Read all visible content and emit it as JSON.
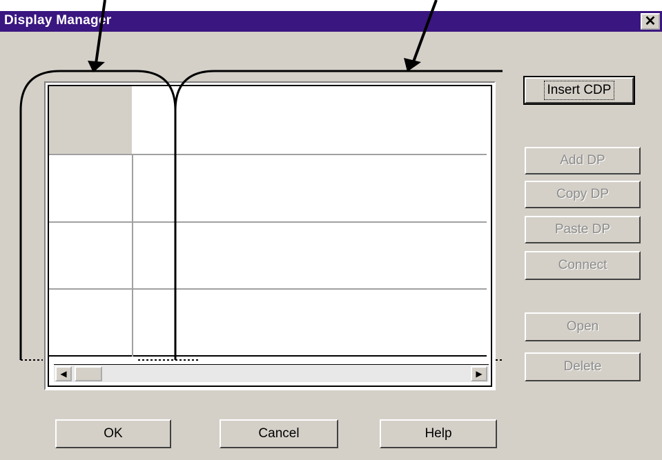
{
  "window": {
    "title": "Display Manager",
    "close_glyph": "✕",
    "colors": {
      "titlebar": "#3a1680",
      "face": "#d4d0c8",
      "disabled_text": "#8c8c8c"
    }
  },
  "grid": {
    "rows": [
      [
        "",
        "",
        ""
      ],
      [
        "",
        "",
        ""
      ],
      [
        "",
        "",
        ""
      ],
      [
        "",
        "",
        ""
      ]
    ],
    "scroll_left_glyph": "◀",
    "scroll_right_glyph": "▶"
  },
  "side_buttons": {
    "insert_cdp": "Insert CDP",
    "add_dp": "Add DP",
    "copy_dp": "Copy DP",
    "paste_dp": "Paste DP",
    "connect": "Connect",
    "open": "Open",
    "delete": "Delete"
  },
  "bottom_buttons": {
    "ok": "OK",
    "cancel": "Cancel",
    "help": "Help"
  },
  "annotations": {
    "arrow_icons": [
      "arrow-down-left-icon",
      "arrow-down-right-icon"
    ],
    "bracket_icons": [
      "bracket-left-icon",
      "bracket-right-icon"
    ]
  }
}
